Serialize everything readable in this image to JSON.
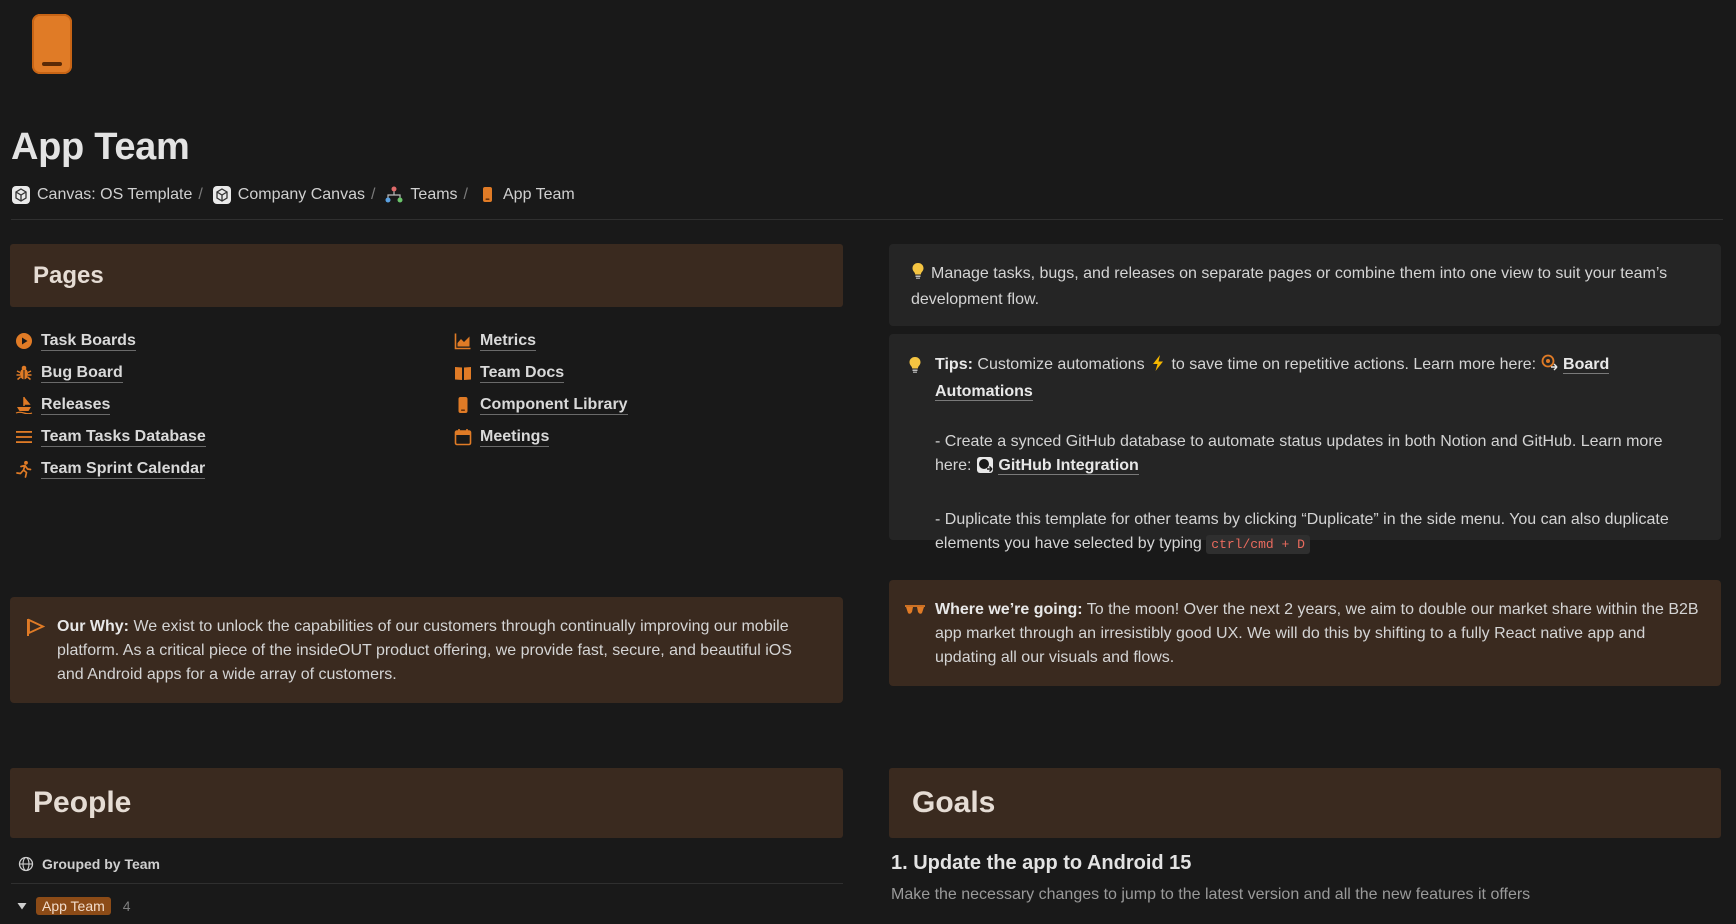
{
  "page": {
    "title": "App Team",
    "icon": "mobile-phone-icon",
    "accent_color": "#e07b26"
  },
  "breadcrumb": [
    {
      "label": "Canvas: OS Template",
      "icon": "canvas-cube-icon"
    },
    {
      "label": "Company Canvas",
      "icon": "canvas-cube-icon"
    },
    {
      "label": "Teams",
      "icon": "org-chart-icon"
    },
    {
      "label": "App Team",
      "icon": "mobile-phone-icon"
    }
  ],
  "pages_section": {
    "heading": "Pages",
    "left_links": [
      {
        "label": "Task Boards",
        "icon": "play-circle-icon"
      },
      {
        "label": "Bug Board",
        "icon": "bug-icon"
      },
      {
        "label": "Releases",
        "icon": "ship-icon"
      },
      {
        "label": "Team Tasks Database",
        "icon": "list-lines-icon"
      },
      {
        "label": "Team Sprint Calendar",
        "icon": "running-person-icon"
      }
    ],
    "right_links": [
      {
        "label": "Metrics",
        "icon": "area-chart-icon"
      },
      {
        "label": "Team Docs",
        "icon": "open-book-icon"
      },
      {
        "label": "Component Library",
        "icon": "mobile-phone-icon"
      },
      {
        "label": "Meetings",
        "icon": "calendar-icon"
      }
    ]
  },
  "intro_callout": {
    "icon": "lightbulb-icon",
    "text": "Manage tasks, bugs, and releases on separate pages or combine them into one view to suit your team’s development flow."
  },
  "tips_callout": {
    "icon": "lightbulb-icon",
    "label": "Tips:",
    "text_before": "Customize automations",
    "lightning_icon": "lightning-icon",
    "text_after": "to save time on repetitive actions. Learn more here:",
    "link1_icon": "automation-link-icon",
    "link1": "Board Automations",
    "bullet2": "- Create a synced GitHub database to automate status updates in both Notion and GitHub. Learn more here:",
    "link2_icon": "github-link-icon",
    "link2": "GitHub Integration",
    "bullet3": "- Duplicate this template for other teams by clicking “Duplicate” in the side menu. You can also duplicate elements you have selected by typing",
    "shortcut": "ctrl/cmd + D"
  },
  "why_callout": {
    "icon": "flag-icon",
    "label": "Our Why:",
    "text": "We exist to unlock the capabilities of our customers through continually improving our mobile platform.  As a critical piece of the insideOUT product offering, we provide fast, secure, and beautiful iOS and Android apps for a wide array of customers."
  },
  "going_callout": {
    "icon": "sunglasses-icon",
    "label": "Where we’re going:",
    "text": "To the moon! Over the next 2 years, we aim to double our market share within the B2B app market through an irresistibly good UX. We will do this by shifting to a fully React native app and updating all our visuals and flows."
  },
  "people_section": {
    "heading": "People",
    "grouping_label": "Grouped by Team",
    "group_name": "App Team",
    "group_count": "4"
  },
  "goals_section": {
    "heading": "Goals",
    "goal1_title": "1. Update the app to Android 15",
    "goal1_desc": "Make the necessary changes to jump to the latest version and all the new features it offers"
  }
}
